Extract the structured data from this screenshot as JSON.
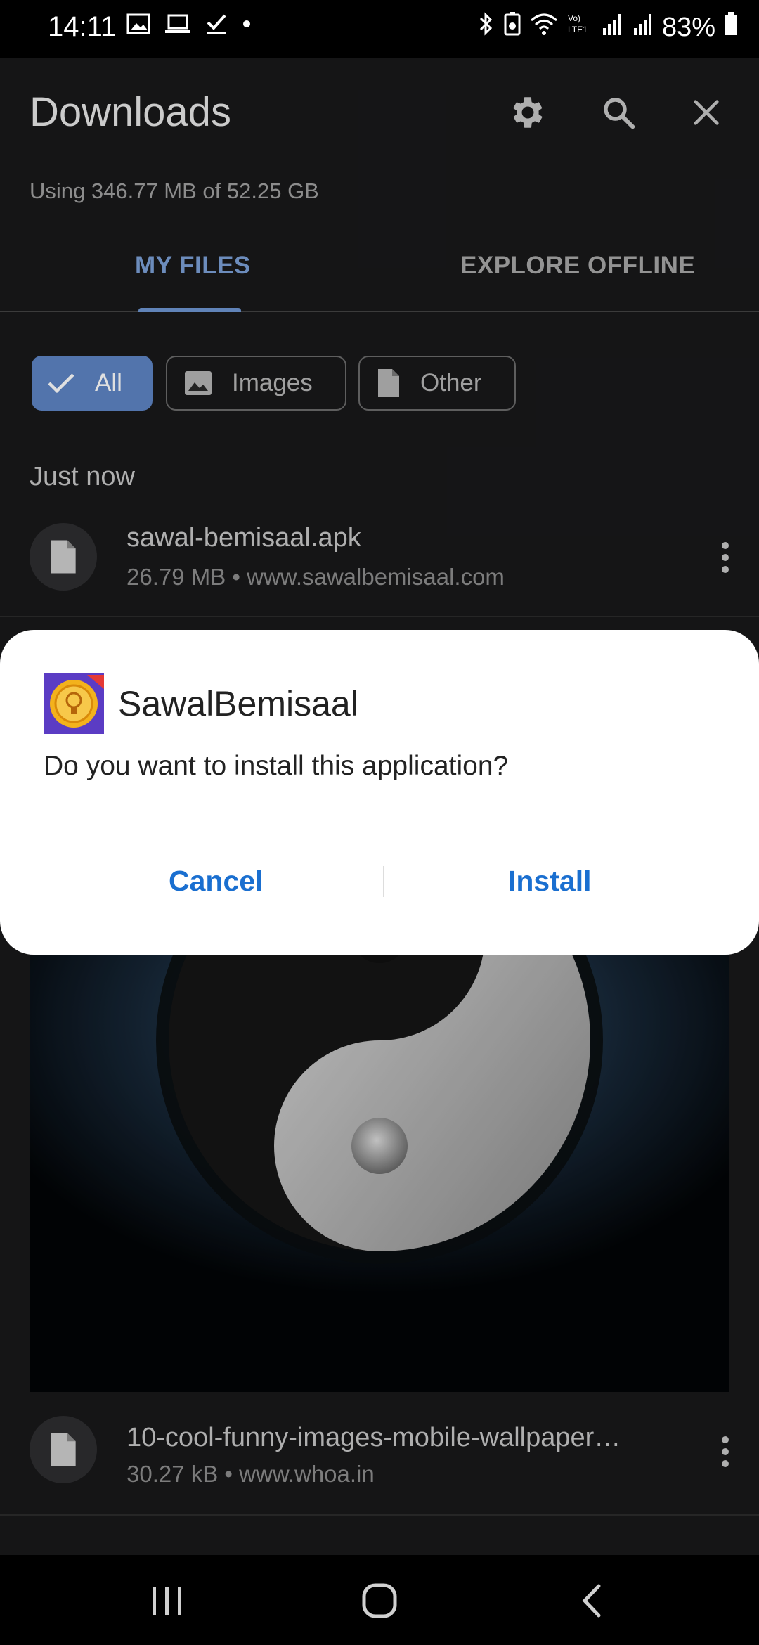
{
  "status_bar": {
    "time": "14:11",
    "battery": "83%"
  },
  "header": {
    "title": "Downloads",
    "storage": "Using 346.77 MB of 52.25 GB"
  },
  "tabs": [
    {
      "label": "MY FILES",
      "selected": true
    },
    {
      "label": "EXPLORE OFFLINE",
      "selected": false
    }
  ],
  "filters": [
    {
      "label": "All",
      "selected": true
    },
    {
      "label": "Images",
      "selected": false
    },
    {
      "label": "Other",
      "selected": false
    }
  ],
  "section": "Just now",
  "files": [
    {
      "name": "sawal-bemisaal.apk",
      "meta": "26.79 MB • www.sawalbemisaal.com"
    },
    {
      "name": "10-cool-funny-images-mobile-wallpaper…",
      "meta": "30.27 kB • www.whoa.in"
    }
  ],
  "dialog": {
    "app_name": "SawalBemisaal",
    "message": "Do you want to install this application?",
    "cancel": "Cancel",
    "install": "Install"
  },
  "colors": {
    "accent": "#6e96d2",
    "dialog_button": "#1a6fd0",
    "background": "#18181a"
  }
}
